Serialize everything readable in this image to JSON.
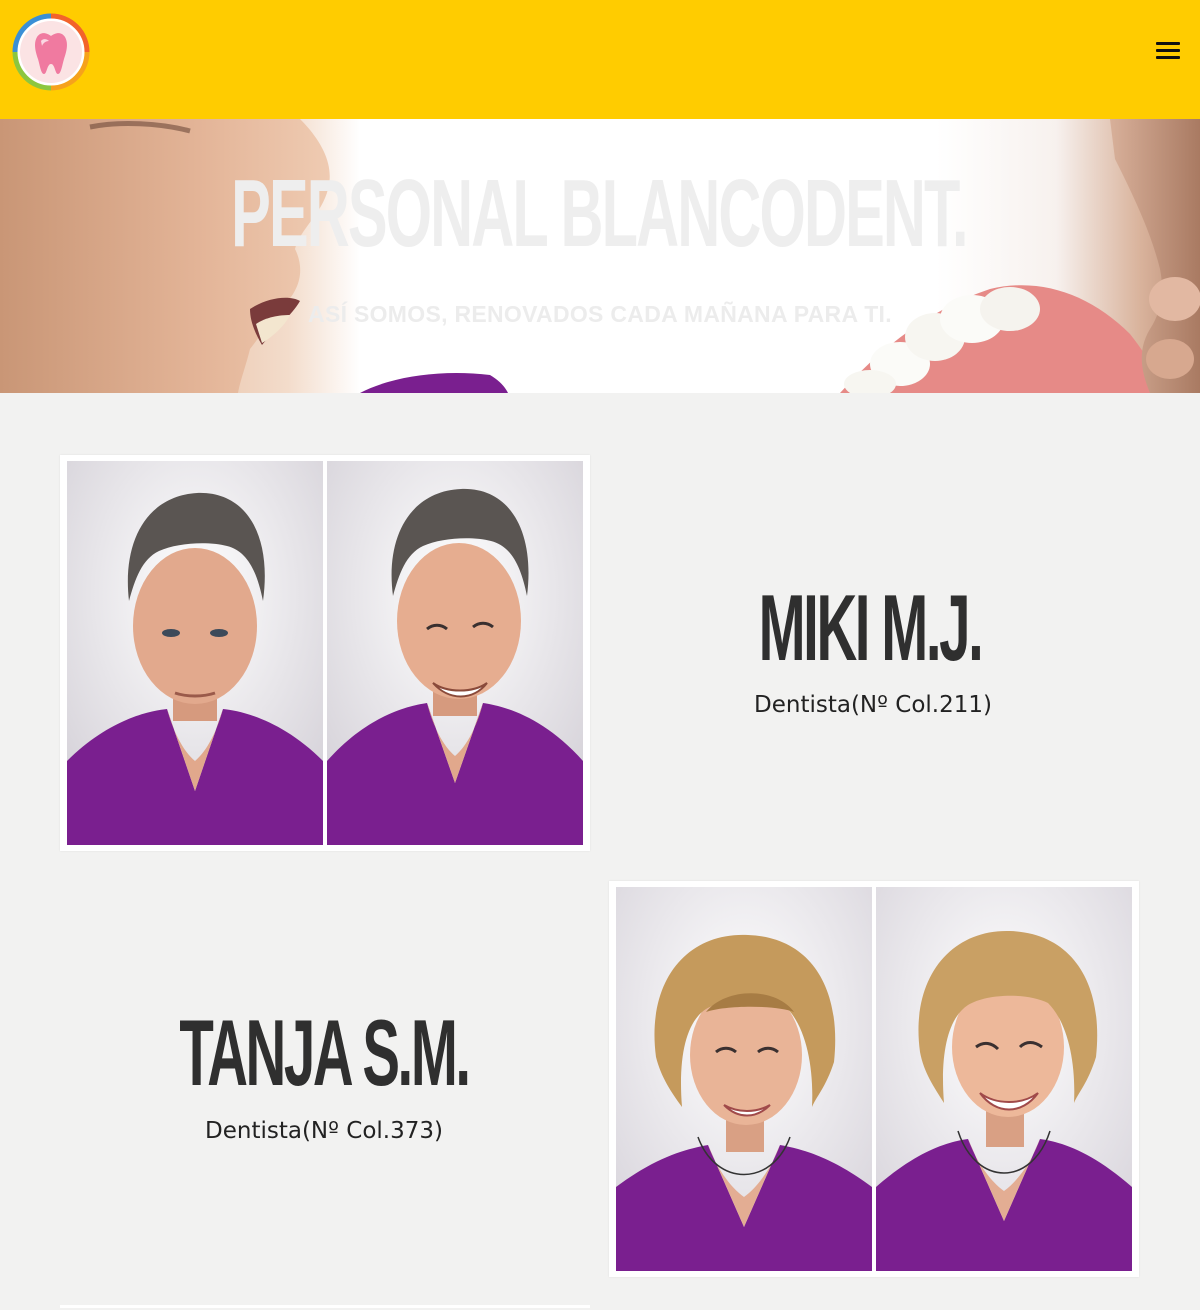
{
  "header": {
    "logo_icon": "tooth-logo-icon",
    "menu_icon": "hamburger-menu-icon",
    "brand_color": "#ffcc00"
  },
  "hero": {
    "title": "PERSONAL BLANCODENT.",
    "subtitle": "ASÍ SOMOS, RENOVADOS CADA MAÑANA PARA TI."
  },
  "staff": [
    {
      "name": "MIKI M.J.",
      "role": "Dentista(Nº Col.211)"
    },
    {
      "name": "TANJA S.M.",
      "role": "Dentista(Nº Col.373)"
    }
  ],
  "colors": {
    "background": "#f2f2f1",
    "scrubs": "#7a1f8f",
    "text": "#2f2f2f"
  }
}
